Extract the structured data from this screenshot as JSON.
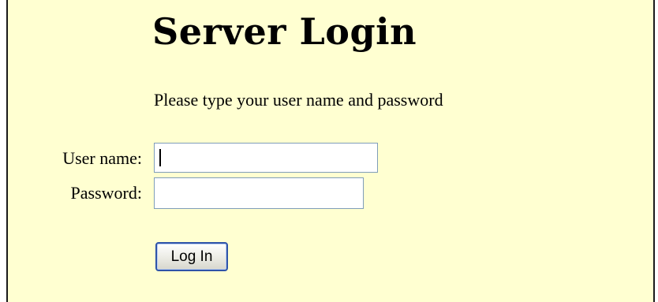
{
  "page": {
    "title": "Server Login",
    "instructions": "Please type your user name and password"
  },
  "form": {
    "username_label": "User name:",
    "username_value": "",
    "password_label": "Password:",
    "password_value": "",
    "submit_label": "Log In"
  },
  "colors": {
    "background": "#ffffd1",
    "input_border": "#7f9db9",
    "button_border": "#2f54a8"
  }
}
